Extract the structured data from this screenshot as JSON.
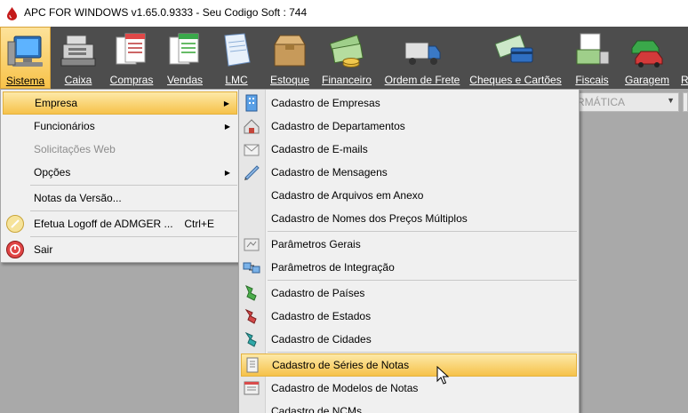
{
  "window": {
    "title": "APC FOR WINDOWS v1.65.0.9333 - Seu Codigo Soft : 744"
  },
  "toolbar": {
    "items": [
      {
        "label": "Sistema",
        "icon": "computer-icon"
      },
      {
        "label": "Caixa",
        "icon": "cash-register-icon"
      },
      {
        "label": "Compras",
        "icon": "purchase-forms-icon"
      },
      {
        "label": "Vendas",
        "icon": "sales-forms-icon"
      },
      {
        "label": "LMC",
        "icon": "document-icon"
      },
      {
        "label": "Estoque",
        "icon": "box-icon"
      },
      {
        "label": "Financeiro",
        "icon": "money-icon"
      },
      {
        "label": "Ordem de Frete",
        "icon": "truck-icon"
      },
      {
        "label": "Cheques e Cartões",
        "icon": "checks-cards-icon"
      },
      {
        "label": "Fiscais",
        "icon": "fiscal-icon"
      },
      {
        "label": "Garagem",
        "icon": "cars-icon"
      },
      {
        "label": "R",
        "icon": "report-icon"
      }
    ]
  },
  "combo": {
    "value": "RMÁTICA"
  },
  "main_menu": {
    "items": [
      {
        "label": "Empresa",
        "submenu": true,
        "highlighted": true
      },
      {
        "label": "Funcionários",
        "submenu": true
      },
      {
        "label": "Solicitações Web",
        "disabled": true
      },
      {
        "label": "Opções",
        "submenu": true
      },
      {
        "label": "Notas da Versão..."
      },
      {
        "label": "Efetua Logoff de ADMGER ...",
        "shortcut": "Ctrl+E",
        "icon": "logoff-icon"
      },
      {
        "label": "Sair",
        "icon": "exit-icon"
      }
    ]
  },
  "empresa_menu": {
    "items": [
      {
        "label": "Cadastro de Empresas",
        "icon": "building-icon"
      },
      {
        "label": "Cadastro de Departamentos",
        "icon": "department-icon"
      },
      {
        "label": "Cadastro de E-mails",
        "icon": "email-icon"
      },
      {
        "label": "Cadastro de Mensagens",
        "icon": "message-icon"
      },
      {
        "label": "Cadastro de Arquivos em Anexo"
      },
      {
        "label": "Cadastro de Nomes dos Preços Múltiplos"
      },
      {
        "label": "Parâmetros Gerais",
        "icon": "settings-icon"
      },
      {
        "label": "Parâmetros de Integração",
        "icon": "integration-icon"
      },
      {
        "label": "Cadastro de Países",
        "icon": "country-icon"
      },
      {
        "label": "Cadastro de Estados",
        "icon": "state-icon"
      },
      {
        "label": "Cadastro de Cidades",
        "icon": "city-icon"
      },
      {
        "label": "Cadastro de Séries de Notas",
        "icon": "notes-series-icon",
        "highlighted": true
      },
      {
        "label": "Cadastro de Modelos de Notas",
        "icon": "notes-model-icon"
      },
      {
        "label": "Cadastro de NCMs"
      }
    ]
  },
  "colors": {
    "toolbar_bg": "#4d4d4d",
    "highlight": "#f8c34a",
    "workspace": "#a9a9a9"
  }
}
